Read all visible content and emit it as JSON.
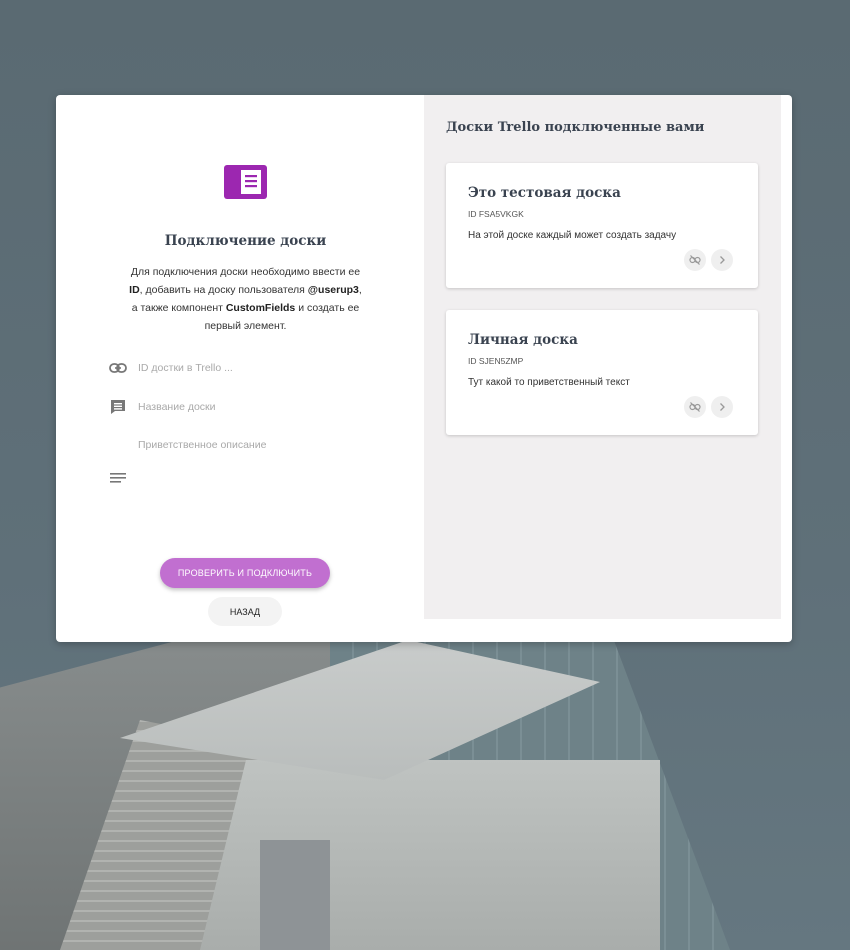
{
  "colors": {
    "accent": "#9c27b0",
    "button": "#c16fd0",
    "panel": "#f1eff0"
  },
  "connect": {
    "title": "Подключение доски",
    "desc": {
      "p1": "Для подключения доски необходимо ввести ее ",
      "id": "ID",
      "p2": ", добавить на доску пользователя ",
      "user": "@userup3",
      "p3": ", а также компонент ",
      "component": "CustomFields",
      "p4": " и создать ее первый элемент."
    },
    "fields": {
      "board_id_placeholder": "ID достки в Trello ...",
      "board_name_placeholder": "Название доски",
      "welcome_placeholder": "Приветственное описание"
    },
    "submit_label": "ПРОВЕРИТЬ И ПОДКЛЮЧИТЬ",
    "back_label": "НАЗАД"
  },
  "boards_panel": {
    "heading": "Доски Trello подключенные вами",
    "boards": [
      {
        "title": "Это тестовая доска",
        "id": "ID FSA5VKGK",
        "description": "На этой доске каждый может создать задачу"
      },
      {
        "title": "Личная доска",
        "id": "ID SJEN5ZMP",
        "description": "Тут какой то приветственный текст"
      }
    ]
  }
}
